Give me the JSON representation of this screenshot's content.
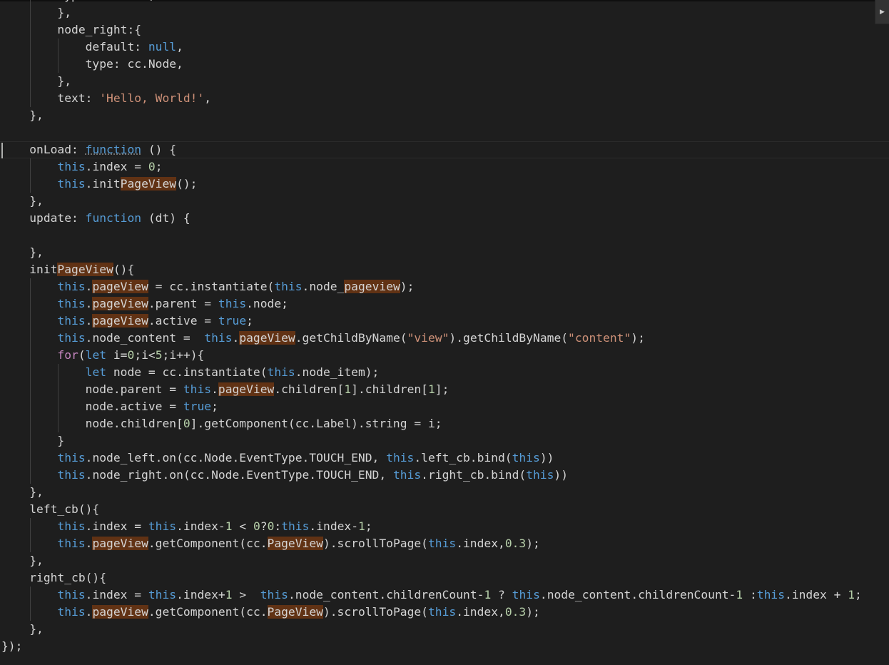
{
  "editor": {
    "language": "javascript",
    "minimap_toggle_icon": "chevron-right-icon",
    "colors": {
      "background": "#1e1e1e",
      "default_text": "#d4d4d4",
      "keyword": "#569cd6",
      "string": "#ce9178",
      "number": "#b5cea8",
      "function": "#dcdcaa",
      "variable": "#9cdcfe",
      "control": "#c586c0",
      "find_highlight": "#613214"
    }
  },
  "code_lines": [
    [
      [
        "p",
        "        type: cc.Node,"
      ]
    ],
    [
      [
        "p",
        "        },"
      ]
    ],
    [
      [
        "p",
        "        node_right:{"
      ]
    ],
    [
      [
        "p",
        "            default: "
      ],
      [
        "k",
        "null"
      ],
      [
        "p",
        ","
      ]
    ],
    [
      [
        "p",
        "            type: cc.Node,"
      ]
    ],
    [
      [
        "p",
        "        },"
      ]
    ],
    [
      [
        "p",
        "        text: "
      ],
      [
        "s",
        "'Hello, World!'"
      ],
      [
        "p",
        ","
      ]
    ],
    [
      [
        "p",
        "    },"
      ]
    ],
    [
      [
        "p",
        ""
      ]
    ],
    [
      [
        "p",
        "    onLoad: "
      ],
      [
        "q",
        "function"
      ],
      [
        "p",
        " () {"
      ]
    ],
    [
      [
        "p",
        "        "
      ],
      [
        "k",
        "this"
      ],
      [
        "p",
        ".index = "
      ],
      [
        "n",
        "0"
      ],
      [
        "p",
        ";"
      ]
    ],
    [
      [
        "p",
        "        "
      ],
      [
        "k",
        "this"
      ],
      [
        "p",
        ".init"
      ],
      [
        "h",
        "PageView"
      ],
      [
        "p",
        "();"
      ]
    ],
    [
      [
        "p",
        "    },"
      ]
    ],
    [
      [
        "p",
        "    update: "
      ],
      [
        "k",
        "function"
      ],
      [
        "p",
        " (dt) {"
      ]
    ],
    [
      [
        "p",
        ""
      ]
    ],
    [
      [
        "p",
        "    },"
      ]
    ],
    [
      [
        "p",
        "    init"
      ],
      [
        "h",
        "PageView"
      ],
      [
        "p",
        "(){"
      ]
    ],
    [
      [
        "p",
        "        "
      ],
      [
        "k",
        "this"
      ],
      [
        "p",
        "."
      ],
      [
        "h",
        "pageView"
      ],
      [
        "p",
        " = cc.instantiate("
      ],
      [
        "k",
        "this"
      ],
      [
        "p",
        ".node_"
      ],
      [
        "h",
        "pageview"
      ],
      [
        "p",
        ");"
      ]
    ],
    [
      [
        "p",
        "        "
      ],
      [
        "k",
        "this"
      ],
      [
        "p",
        "."
      ],
      [
        "h",
        "pageView"
      ],
      [
        "p",
        ".parent = "
      ],
      [
        "k",
        "this"
      ],
      [
        "p",
        ".node;"
      ]
    ],
    [
      [
        "p",
        "        "
      ],
      [
        "k",
        "this"
      ],
      [
        "p",
        "."
      ],
      [
        "h",
        "pageView"
      ],
      [
        "p",
        ".active = "
      ],
      [
        "k",
        "true"
      ],
      [
        "p",
        ";"
      ]
    ],
    [
      [
        "p",
        "        "
      ],
      [
        "k",
        "this"
      ],
      [
        "p",
        ".node_content =  "
      ],
      [
        "k",
        "this"
      ],
      [
        "p",
        "."
      ],
      [
        "h",
        "pageView"
      ],
      [
        "p",
        ".getChildByName("
      ],
      [
        "s",
        "\"view\""
      ],
      [
        "p",
        ").getChildByName("
      ],
      [
        "s",
        "\"content\""
      ],
      [
        "p",
        ");"
      ]
    ],
    [
      [
        "p",
        "        "
      ],
      [
        "c",
        "for"
      ],
      [
        "p",
        "("
      ],
      [
        "k",
        "let"
      ],
      [
        "p",
        " i="
      ],
      [
        "n",
        "0"
      ],
      [
        "p",
        ";i<"
      ],
      [
        "n",
        "5"
      ],
      [
        "p",
        ";i++){"
      ]
    ],
    [
      [
        "p",
        "            "
      ],
      [
        "k",
        "let"
      ],
      [
        "p",
        " node = cc.instantiate("
      ],
      [
        "k",
        "this"
      ],
      [
        "p",
        ".node_item);"
      ]
    ],
    [
      [
        "p",
        "            node.parent = "
      ],
      [
        "k",
        "this"
      ],
      [
        "p",
        "."
      ],
      [
        "h",
        "pageView"
      ],
      [
        "p",
        ".children["
      ],
      [
        "n",
        "1"
      ],
      [
        "p",
        "].children["
      ],
      [
        "n",
        "1"
      ],
      [
        "p",
        "];"
      ]
    ],
    [
      [
        "p",
        "            node.active = "
      ],
      [
        "k",
        "true"
      ],
      [
        "p",
        ";"
      ]
    ],
    [
      [
        "p",
        "            node.children["
      ],
      [
        "n",
        "0"
      ],
      [
        "p",
        "].getComponent(cc.Label).string = i;"
      ]
    ],
    [
      [
        "p",
        "        }"
      ]
    ],
    [
      [
        "p",
        "        "
      ],
      [
        "k",
        "this"
      ],
      [
        "p",
        ".node_left.on(cc.Node.EventType.TOUCH_END, "
      ],
      [
        "k",
        "this"
      ],
      [
        "p",
        ".left_cb.bind("
      ],
      [
        "k",
        "this"
      ],
      [
        "p",
        "))"
      ]
    ],
    [
      [
        "p",
        "        "
      ],
      [
        "k",
        "this"
      ],
      [
        "p",
        ".node_right.on(cc.Node.EventType.TOUCH_END, "
      ],
      [
        "k",
        "this"
      ],
      [
        "p",
        ".right_cb.bind("
      ],
      [
        "k",
        "this"
      ],
      [
        "p",
        "))"
      ]
    ],
    [
      [
        "p",
        "    },"
      ]
    ],
    [
      [
        "p",
        "    left_cb(){"
      ]
    ],
    [
      [
        "p",
        "        "
      ],
      [
        "k",
        "this"
      ],
      [
        "p",
        ".index = "
      ],
      [
        "k",
        "this"
      ],
      [
        "p",
        ".index-"
      ],
      [
        "n",
        "1"
      ],
      [
        "p",
        " < "
      ],
      [
        "n",
        "0"
      ],
      [
        "p",
        "?"
      ],
      [
        "n",
        "0"
      ],
      [
        "p",
        ":"
      ],
      [
        "k",
        "this"
      ],
      [
        "p",
        ".index-"
      ],
      [
        "n",
        "1"
      ],
      [
        "p",
        ";"
      ]
    ],
    [
      [
        "p",
        "        "
      ],
      [
        "k",
        "this"
      ],
      [
        "p",
        "."
      ],
      [
        "h",
        "pageView"
      ],
      [
        "p",
        ".getComponent(cc."
      ],
      [
        "h",
        "PageView"
      ],
      [
        "p",
        ").scrollToPage("
      ],
      [
        "k",
        "this"
      ],
      [
        "p",
        ".index,"
      ],
      [
        "n",
        "0.3"
      ],
      [
        "p",
        ");"
      ]
    ],
    [
      [
        "p",
        "    },"
      ]
    ],
    [
      [
        "p",
        "    right_cb(){"
      ]
    ],
    [
      [
        "p",
        "        "
      ],
      [
        "k",
        "this"
      ],
      [
        "p",
        ".index = "
      ],
      [
        "k",
        "this"
      ],
      [
        "p",
        ".index+"
      ],
      [
        "n",
        "1"
      ],
      [
        "p",
        " >  "
      ],
      [
        "k",
        "this"
      ],
      [
        "p",
        ".node_content.childrenCount-"
      ],
      [
        "n",
        "1"
      ],
      [
        "p",
        " ? "
      ],
      [
        "k",
        "this"
      ],
      [
        "p",
        ".node_content.childrenCount-"
      ],
      [
        "n",
        "1"
      ],
      [
        "p",
        " :"
      ],
      [
        "k",
        "this"
      ],
      [
        "p",
        ".index + "
      ],
      [
        "n",
        "1"
      ],
      [
        "p",
        ";"
      ]
    ],
    [
      [
        "p",
        "        "
      ],
      [
        "k",
        "this"
      ],
      [
        "p",
        "."
      ],
      [
        "h",
        "pageView"
      ],
      [
        "p",
        ".getComponent(cc."
      ],
      [
        "h",
        "PageView"
      ],
      [
        "p",
        ").scrollToPage("
      ],
      [
        "k",
        "this"
      ],
      [
        "p",
        ".index,"
      ],
      [
        "n",
        "0.3"
      ],
      [
        "p",
        ");"
      ]
    ],
    [
      [
        "p",
        "    },"
      ]
    ],
    [
      [
        "p",
        "});"
      ]
    ]
  ],
  "current_line": 9
}
